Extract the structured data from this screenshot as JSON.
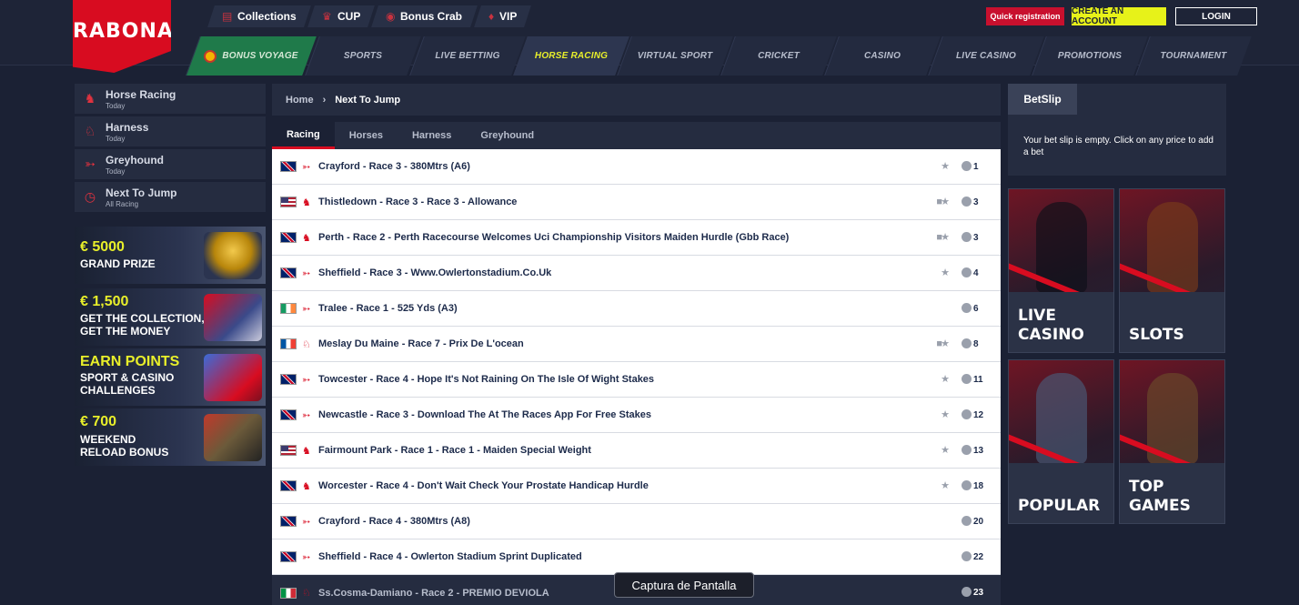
{
  "header": {
    "logo": "RABONA",
    "top_menu": [
      {
        "label": "Collections",
        "icon": "book-icon"
      },
      {
        "label": "CUP",
        "icon": "trophy-icon"
      },
      {
        "label": "Bonus Crab",
        "icon": "crab-icon"
      },
      {
        "label": "VIP",
        "icon": "diamond-icon"
      }
    ],
    "quick_registration": "Quick registration",
    "create_account": "CREATE AN ACCOUNT",
    "login": "LOGIN"
  },
  "nav": [
    {
      "label": "BONUS VOYAGE"
    },
    {
      "label": "SPORTS"
    },
    {
      "label": "LIVE BETTING"
    },
    {
      "label": "HORSE RACING"
    },
    {
      "label": "VIRTUAL SPORT"
    },
    {
      "label": "CRICKET"
    },
    {
      "label": "CASINO"
    },
    {
      "label": "LIVE CASINO"
    },
    {
      "label": "PROMOTIONS"
    },
    {
      "label": "TOURNAMENT"
    }
  ],
  "sidebar": {
    "items": [
      {
        "title": "Horse Racing",
        "sub": "Today"
      },
      {
        "title": "Harness",
        "sub": "Today"
      },
      {
        "title": "Greyhound",
        "sub": "Today"
      },
      {
        "title": "Next To Jump",
        "sub": "All Racing"
      }
    ],
    "promos": [
      {
        "line1": "€ 5000",
        "line2": "GRAND PRIZE"
      },
      {
        "line1": "€ 1,500",
        "line2": "GET THE COLLECTION,",
        "line3": "GET THE MONEY"
      },
      {
        "line1": "EARN POINTS",
        "line2": "SPORT & CASINO",
        "line3": "CHALLENGES"
      },
      {
        "line1": "€ 700",
        "line2": "WEEKEND",
        "line3": "RELOAD BONUS"
      }
    ]
  },
  "breadcrumb": {
    "home": "Home",
    "current": "Next To Jump"
  },
  "tabs": [
    "Racing",
    "Horses",
    "Harness",
    "Greyhound"
  ],
  "races": [
    {
      "flag": "gb",
      "name": "Crayford - Race 3 - 380Mtrs (A6)",
      "mins": "1"
    },
    {
      "flag": "us",
      "name": "Thistledown - Race 3 - Race 3 - Allowance",
      "mins": "3"
    },
    {
      "flag": "gb",
      "name": "Perth - Race 2 - Perth Racecourse Welcomes Uci Championship Visitors Maiden Hurdle (Gbb Race)",
      "mins": "3"
    },
    {
      "flag": "gb",
      "name": "Sheffield - Race 3 - Www.Owlertonstadium.Co.Uk",
      "mins": "4"
    },
    {
      "flag": "ie",
      "name": "Tralee - Race 1 - 525 Yds (A3)",
      "mins": "6"
    },
    {
      "flag": "fr",
      "name": "Meslay Du Maine - Race 7 - Prix De L'ocean",
      "mins": "8"
    },
    {
      "flag": "gb",
      "name": "Towcester - Race 4 - Hope It's Not Raining On The Isle Of Wight Stakes",
      "mins": "11"
    },
    {
      "flag": "gb",
      "name": "Newcastle - Race 3 - Download The At The Races App For Free Stakes",
      "mins": "12"
    },
    {
      "flag": "us",
      "name": "Fairmount Park - Race 1 - Race 1 - Maiden Special Weight",
      "mins": "13"
    },
    {
      "flag": "gb",
      "name": "Worcester - Race 4 - Don't Wait Check Your Prostate Handicap Hurdle",
      "mins": "18"
    },
    {
      "flag": "gb",
      "name": "Crayford - Race 4 - 380Mtrs (A8)",
      "mins": "20"
    },
    {
      "flag": "gb",
      "name": "Sheffield - Race 4 - Owlerton Stadium Sprint Duplicated",
      "mins": "22"
    },
    {
      "flag": "it",
      "name": "Ss.Cosma-Damiano - Race 2 - PREMIO DEVIOLA",
      "mins": "23"
    }
  ],
  "tooltip": "Captura de Pantalla",
  "betslip": {
    "tab": "BetSlip",
    "message": "Your bet slip is empty. Click on any price to add a bet"
  },
  "tiles": [
    {
      "line1": "LIVE",
      "line2": "CASINO"
    },
    {
      "line1": "SLOTS",
      "line2": ""
    },
    {
      "line1": "POPULAR",
      "line2": ""
    },
    {
      "line1": "TOP GAMES",
      "line2": ""
    }
  ],
  "colors": {
    "brand_red": "#d80c20",
    "accent_yellow": "#e8ef2a",
    "bg": "#1b2134"
  }
}
